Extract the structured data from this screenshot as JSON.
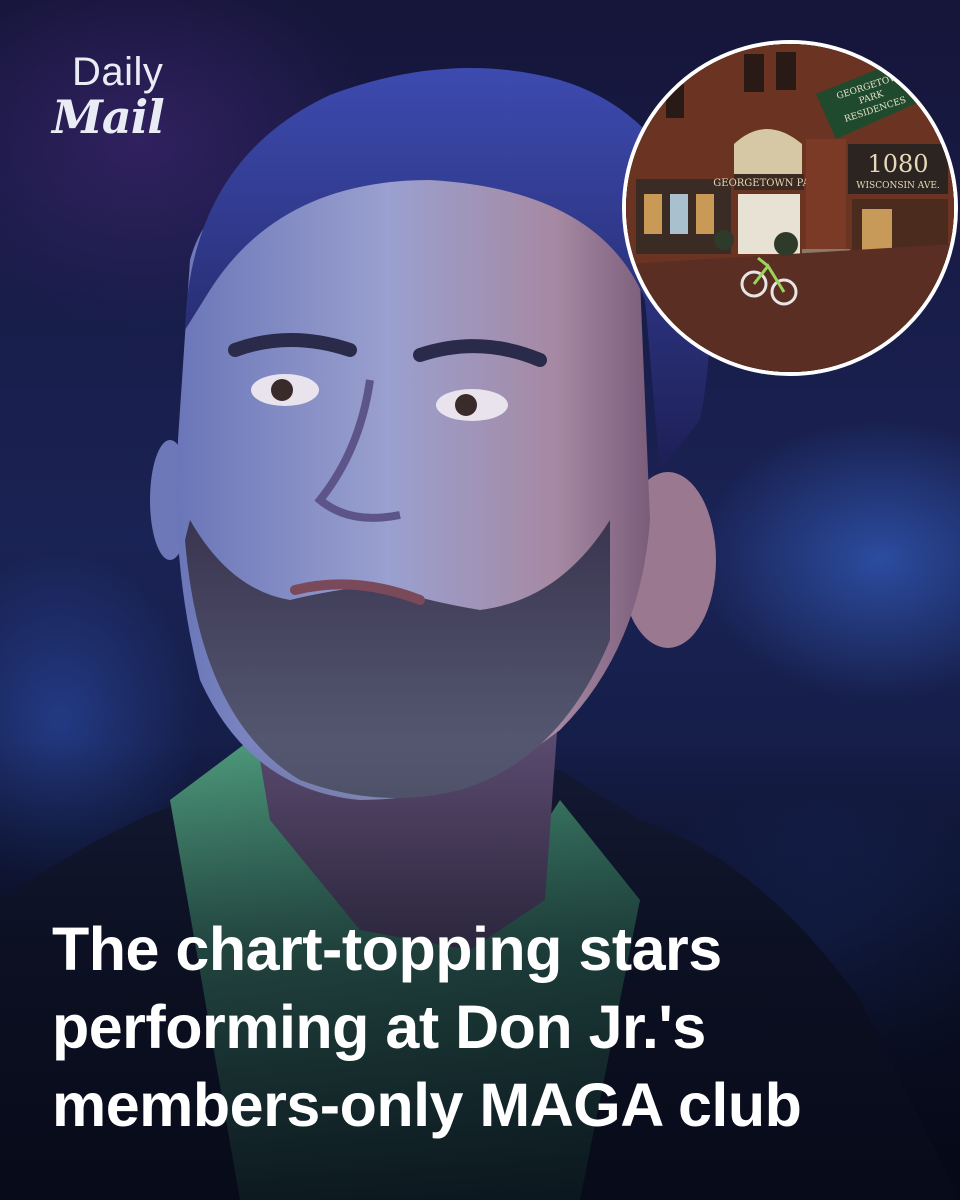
{
  "brand": {
    "logo_top": "Daily",
    "logo_bottom": "Mail"
  },
  "inset_photo": {
    "sign_text": [
      "GEORGETOWN",
      "PARK",
      "RESIDENCES"
    ],
    "address_number": "1080",
    "street": "WISCONSIN AVE.",
    "storefront": "GEORGETOWN PARK"
  },
  "headline": {
    "line1": "The chart-topping stars",
    "line2": "performing at Don Jr.'s",
    "line3": "members-only MAGA club"
  },
  "colors": {
    "headline_text": "#ffffff",
    "background": "#16153a",
    "inset_border": "#ffffff"
  }
}
